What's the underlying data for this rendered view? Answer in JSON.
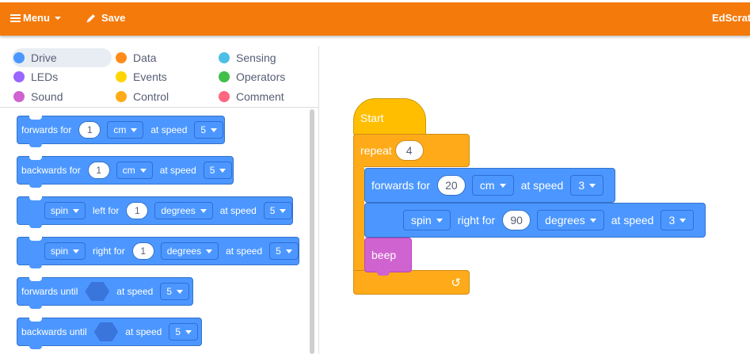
{
  "topbar": {
    "menu_label": "Menu",
    "save_label": "Save",
    "brand": "EdScrat",
    "color": "#f47a0c"
  },
  "categories": [
    {
      "label": "Drive",
      "color": "#4c97ff",
      "selected": true
    },
    {
      "label": "Data",
      "color": "#ff8c1a"
    },
    {
      "label": "Sensing",
      "color": "#4cbfe6"
    },
    {
      "label": "LEDs",
      "color": "#9966ff"
    },
    {
      "label": "Events",
      "color": "#ffd500"
    },
    {
      "label": "Operators",
      "color": "#40bf4a"
    },
    {
      "label": "Sound",
      "color": "#cf63cf"
    },
    {
      "label": "Control",
      "color": "#ffab19"
    },
    {
      "label": "Comment",
      "color": "#ff6680"
    }
  ],
  "palette": {
    "forwards_for": {
      "label": "forwards for",
      "value": "1",
      "unit": "cm",
      "speed_label": "at speed",
      "speed": "5"
    },
    "backwards_for": {
      "label": "backwards for",
      "value": "1",
      "unit": "cm",
      "speed_label": "at speed",
      "speed": "5"
    },
    "spin_left": {
      "action": "spin",
      "dir_label": "left for",
      "value": "1",
      "unit": "degrees",
      "speed_label": "at speed",
      "speed": "5"
    },
    "spin_right": {
      "action": "spin",
      "dir_label": "right for",
      "value": "1",
      "unit": "degrees",
      "speed_label": "at speed",
      "speed": "5"
    },
    "forwards_until": {
      "label": "forwards until",
      "speed_label": "at speed",
      "speed": "5"
    },
    "backwards_until": {
      "label": "backwards until",
      "speed_label": "at speed",
      "speed": "5"
    }
  },
  "script": {
    "start_label": "Start",
    "repeat_label": "repeat",
    "repeat_count": "4",
    "forwards": {
      "label": "forwards for",
      "value": "20",
      "unit": "cm",
      "speed_label": "at speed",
      "speed": "3"
    },
    "spin": {
      "action": "spin",
      "dir_label": "right for",
      "value": "90",
      "unit": "degrees",
      "speed_label": "at speed",
      "speed": "3"
    },
    "beep_label": "beep",
    "loop_icon": "↺"
  }
}
